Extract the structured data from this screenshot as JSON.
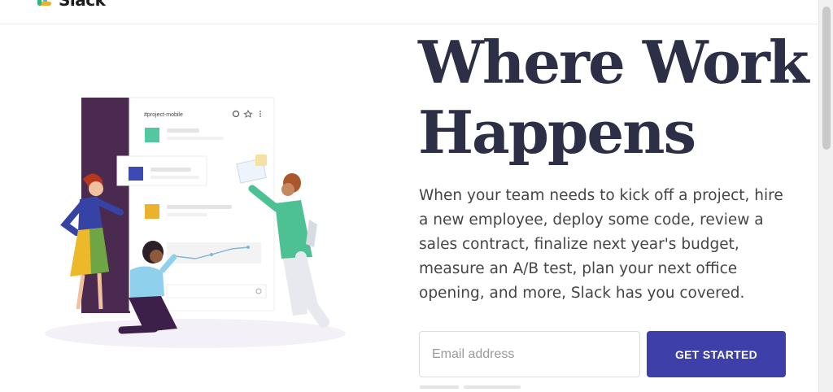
{
  "header": {
    "logo_text": "Slack",
    "logo_colors": [
      "#e01e5a",
      "#36c5f0",
      "#2eb67d",
      "#ecb22e"
    ],
    "menu_icon": "hamburger-menu-icon"
  },
  "hero": {
    "title_line1": "Where Work",
    "title_line2": "Happens",
    "body": "When your team needs to kick off a project, hire a new employee, deploy some code, review a sales contract, finalize next year's budget, measure an A/B test, plan your next office opening, and more, Slack has you covered."
  },
  "signup": {
    "email_placeholder": "Email address",
    "button_label": "GET STARTED",
    "button_color": "#3e3fa8"
  },
  "illustration": {
    "channel_name": "#project-mobile",
    "icons": [
      "at-sign-icon",
      "star-icon",
      "more-vertical-icon"
    ],
    "accent_colors": [
      "#4a154b",
      "#53c7a0",
      "#3b4bb3",
      "#ecb22e"
    ]
  }
}
